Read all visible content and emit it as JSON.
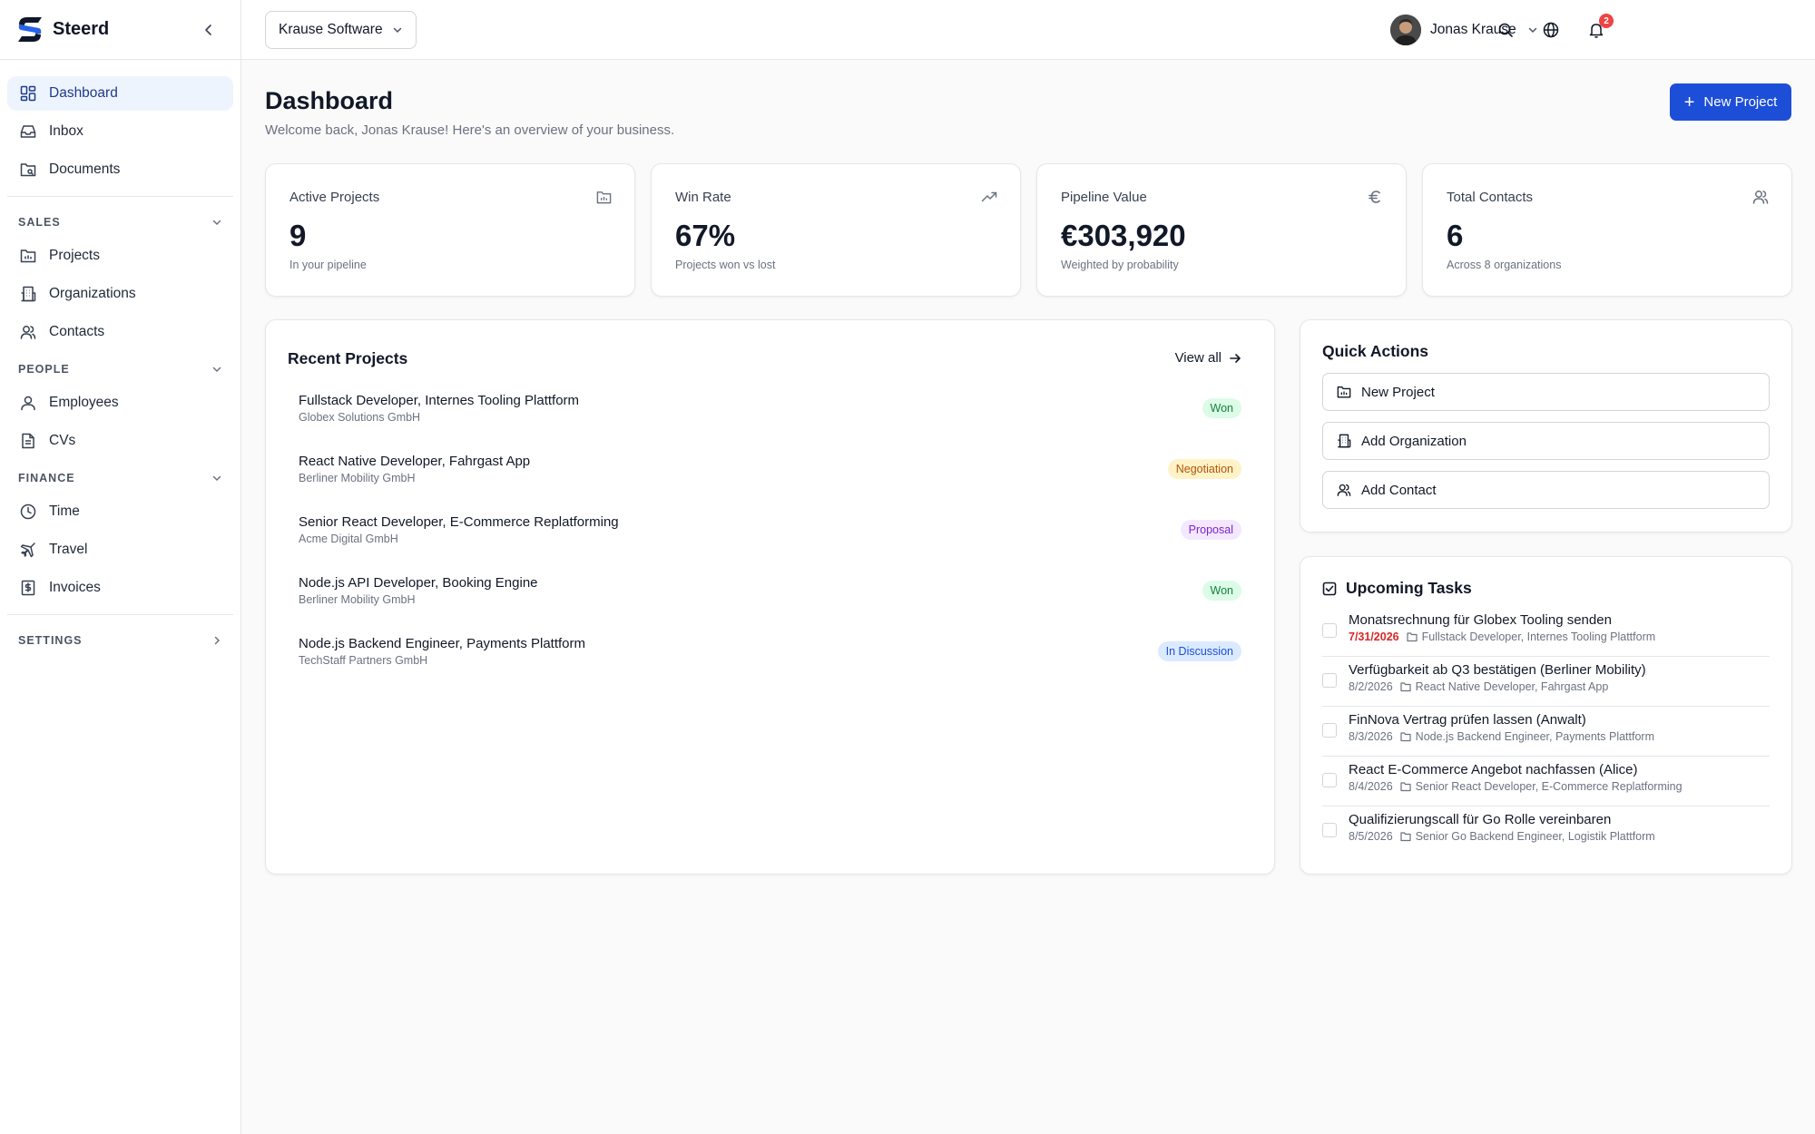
{
  "app": {
    "name": "Steerd"
  },
  "sidebar": {
    "primary": [
      {
        "label": "Dashboard",
        "icon": "dashboard-icon",
        "active": true
      },
      {
        "label": "Inbox",
        "icon": "inbox-icon"
      },
      {
        "label": "Documents",
        "icon": "documents-icon"
      }
    ],
    "sections": [
      {
        "title": "SALES",
        "items": [
          {
            "label": "Projects",
            "icon": "projects-icon"
          },
          {
            "label": "Organizations",
            "icon": "organizations-icon"
          },
          {
            "label": "Contacts",
            "icon": "contacts-icon"
          }
        ]
      },
      {
        "title": "PEOPLE",
        "items": [
          {
            "label": "Employees",
            "icon": "employees-icon"
          },
          {
            "label": "CVs",
            "icon": "cvs-icon"
          }
        ]
      },
      {
        "title": "FINANCE",
        "items": [
          {
            "label": "Time",
            "icon": "clock-icon"
          },
          {
            "label": "Travel",
            "icon": "plane-icon"
          },
          {
            "label": "Invoices",
            "icon": "invoice-icon"
          }
        ]
      }
    ],
    "settings_label": "SETTINGS"
  },
  "topbar": {
    "org_selector": "Krause Software",
    "notifications_count": "2",
    "user_name": "Jonas Krause"
  },
  "header": {
    "title": "Dashboard",
    "subtitle": "Welcome back, Jonas Krause! Here's an overview of your business.",
    "new_project_label": "New Project"
  },
  "stats": [
    {
      "label": "Active Projects",
      "value": "9",
      "caption": "In your pipeline",
      "icon": "folder-icon"
    },
    {
      "label": "Win Rate",
      "value": "67%",
      "caption": "Projects won vs lost",
      "icon": "trending-up-icon"
    },
    {
      "label": "Pipeline Value",
      "value": "€303,920",
      "caption": "Weighted by probability",
      "icon": "euro-icon"
    },
    {
      "label": "Total Contacts",
      "value": "6",
      "caption": "Across 8 organizations",
      "icon": "users-icon"
    }
  ],
  "recent_projects": {
    "title": "Recent Projects",
    "view_all_label": "View all",
    "items": [
      {
        "name": "Fullstack Developer, Internes Tooling Plattform",
        "org": "Globex Solutions GmbH",
        "status": "Won"
      },
      {
        "name": "React Native Developer, Fahrgast App",
        "org": "Berliner Mobility GmbH",
        "status": "Negotiation"
      },
      {
        "name": "Senior React Developer, E-Commerce Replatforming",
        "org": "Acme Digital GmbH",
        "status": "Proposal"
      },
      {
        "name": "Node.js API Developer, Booking Engine",
        "org": "Berliner Mobility GmbH",
        "status": "Won"
      },
      {
        "name": "Node.js Backend Engineer, Payments Plattform",
        "org": "TechStaff Partners GmbH",
        "status": "In Discussion"
      }
    ]
  },
  "status_colors": {
    "Won": {
      "bg": "#dcfce7",
      "fg": "#15803d"
    },
    "Negotiation": {
      "bg": "#fef3c7",
      "fg": "#b45309"
    },
    "Proposal": {
      "bg": "#f3e8ff",
      "fg": "#7e22ce"
    },
    "In Discussion": {
      "bg": "#dbeafe",
      "fg": "#1d4ed8"
    }
  },
  "quick_actions": {
    "title": "Quick Actions",
    "items": [
      {
        "label": "New Project",
        "icon": "folder-icon"
      },
      {
        "label": "Add Organization",
        "icon": "building-icon"
      },
      {
        "label": "Add Contact",
        "icon": "users-icon"
      }
    ]
  },
  "upcoming_tasks": {
    "title": "Upcoming Tasks",
    "items": [
      {
        "title": "Monatsrechnung für Globex Tooling senden",
        "date": "7/31/2026",
        "overdue": true,
        "project": "Fullstack Developer, Internes Tooling Plattform"
      },
      {
        "title": "Verfügbarkeit ab Q3 bestätigen (Berliner Mobility)",
        "date": "8/2/2026",
        "overdue": false,
        "project": "React Native Developer, Fahrgast App"
      },
      {
        "title": "FinNova Vertrag prüfen lassen (Anwalt)",
        "date": "8/3/2026",
        "overdue": false,
        "project": "Node.js Backend Engineer, Payments Plattform"
      },
      {
        "title": "React E-Commerce Angebot nachfassen (Alice)",
        "date": "8/4/2026",
        "overdue": false,
        "project": "Senior React Developer, E-Commerce Replatforming"
      },
      {
        "title": "Qualifizierungscall für Go Rolle vereinbaren",
        "date": "8/5/2026",
        "overdue": false,
        "project": "Senior Go Backend Engineer, Logistik Plattform"
      }
    ]
  },
  "colors": {
    "accent": "#1d4ed8",
    "active_nav_bg": "#eef4fd",
    "overdue": "#dc2626",
    "badge": "#ef4444"
  }
}
